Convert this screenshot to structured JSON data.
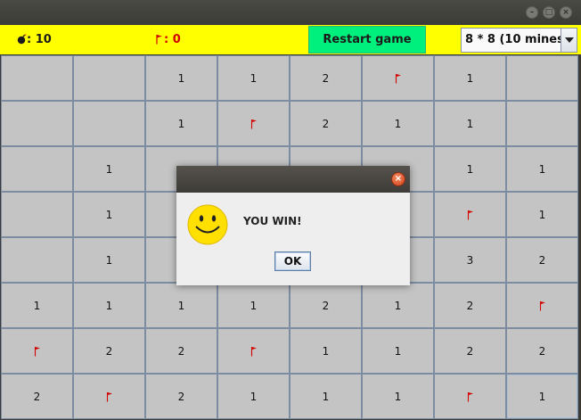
{
  "window": {
    "controls": [
      {
        "name": "minimize",
        "glyph": "–"
      },
      {
        "name": "maximize",
        "glyph": "□"
      },
      {
        "name": "close",
        "glyph": "×"
      }
    ]
  },
  "toolbar": {
    "mine_count_icon": "bomb-icon",
    "mine_count": ": 10",
    "flag_count_icon": "flag-icon",
    "flag_count": ": 0",
    "restart_label": "Restart game",
    "difficulty_selected": "8 * 8 (10 mines)"
  },
  "colors": {
    "toolbar_bg": "#ffff00",
    "restart_bg": "#00f07e",
    "cell_bg": "#c4c4c4",
    "cell_border": "#7d8ca0",
    "flag": "#d40000"
  },
  "board": {
    "rows": [
      [
        "",
        "",
        "1",
        "1",
        "2",
        "F",
        "1",
        ""
      ],
      [
        "",
        "",
        "1",
        "F",
        "2",
        "1",
        "1",
        ""
      ],
      [
        "",
        "1",
        "",
        "",
        "",
        "",
        "1",
        "1"
      ],
      [
        "",
        "1",
        "",
        "",
        "",
        "",
        "F",
        "1"
      ],
      [
        "",
        "1",
        "",
        "",
        "",
        "",
        "3",
        "2"
      ],
      [
        "1",
        "1",
        "1",
        "1",
        "2",
        "1",
        "2",
        "F"
      ],
      [
        "F",
        "2",
        "2",
        "F",
        "1",
        "1",
        "2",
        "2"
      ],
      [
        "2",
        "F",
        "2",
        "1",
        "1",
        "1",
        "F",
        "1"
      ]
    ],
    "flag_symbol": "F"
  },
  "dialog": {
    "icon": "smiley-icon",
    "message": "YOU WIN!",
    "ok_label": "OK",
    "close_glyph": "×"
  }
}
